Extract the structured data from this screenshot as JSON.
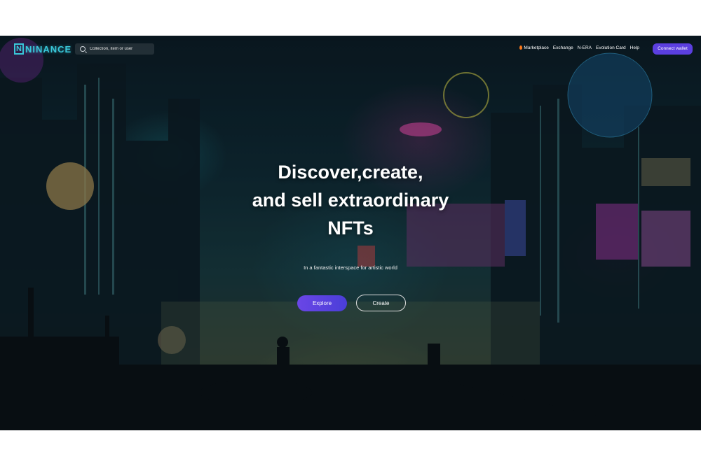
{
  "header": {
    "logo_text": "NINANCE",
    "logo_mark": "N",
    "search": {
      "placeholder": "Collection, item or user",
      "icon": "search-icon"
    },
    "nav": [
      {
        "label": "Marketplace",
        "icon": "flame-icon"
      },
      {
        "label": "Exchange"
      },
      {
        "label": "N-ERA"
      },
      {
        "label": "Evolution Card"
      },
      {
        "label": "Help"
      }
    ],
    "connect_wallet_label": "Connect wallet"
  },
  "hero": {
    "title_lines": [
      "Discover,create,",
      "and sell extraordinary",
      "NFTs"
    ],
    "subtitle": "In a fantastic interspace for artistic world",
    "explore_label": "Explore",
    "create_label": "Create"
  },
  "colors": {
    "accent": "#5b3fe0",
    "logo": "#39c7d9",
    "text": "#ffffff"
  }
}
